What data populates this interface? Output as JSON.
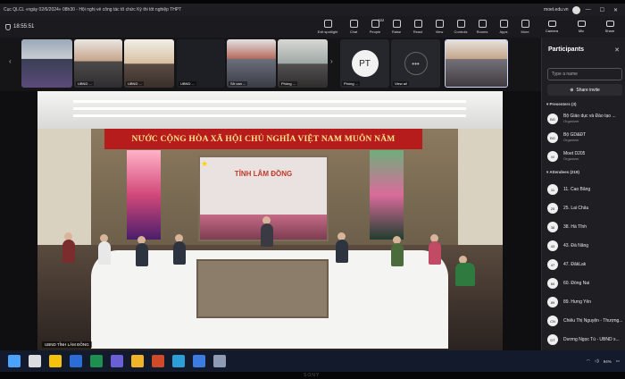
{
  "window": {
    "title": "Cục QLCL «ngày 02/6/2024» 08h30 - Hội nghị về công tác tổ chức Kỳ thi tốt nghiệp THPT",
    "account": "moet.edu.vn"
  },
  "meeting": {
    "elapsed": "18:55:51",
    "tools": [
      {
        "icon": "spotlight-icon",
        "label": "Exit spotlight"
      },
      {
        "icon": "chat-icon",
        "label": "Chat"
      },
      {
        "icon": "people-icon",
        "label": "People",
        "badge": "222"
      },
      {
        "icon": "raise-hand-icon",
        "label": "Raise"
      },
      {
        "icon": "react-icon",
        "label": "React"
      },
      {
        "icon": "view-icon",
        "label": "View"
      },
      {
        "icon": "controls-icon",
        "label": "Controls"
      },
      {
        "icon": "rooms-icon",
        "label": "Rooms"
      },
      {
        "icon": "apps-icon",
        "label": "Apps"
      },
      {
        "icon": "more-icon",
        "label": "More"
      }
    ],
    "camera_label": "Camera",
    "mic_label": "Mic",
    "share_label": "Share"
  },
  "strip": {
    "tiles": [
      {
        "label": ""
      },
      {
        "label": "UBND ..."
      },
      {
        "label": "UBND ..."
      },
      {
        "label": "UBND ..."
      },
      {
        "label": "Sở can ..."
      },
      {
        "label": "Phòng ..."
      },
      {
        "initials": "PT",
        "label": "Phòng ..."
      },
      {
        "more": "•••",
        "label": "View all"
      },
      {
        "label": ""
      }
    ]
  },
  "stage": {
    "banner": "NƯỚC CỘNG HÒA XÃ HỘI CHỦ NGHĨA VIỆT NAM MUÔN NĂM",
    "screen_text": "TỈNH LÂM ĐỒNG",
    "name_label": "UBND TỈNH LÂM ĐỒNG"
  },
  "participants": {
    "title": "Participants",
    "search_placeholder": "Type a name",
    "share_invite": "Share invite",
    "presenters_header": "Presenters (3)",
    "presenters": [
      {
        "initials": "BG",
        "name": "Bộ Giáo dục và Đào tạo ...",
        "role": "Organizer"
      },
      {
        "initials": "BG",
        "name": "Bộ GD&ĐT",
        "role": "Organizer"
      },
      {
        "initials": "M",
        "name": "Moet D205",
        "role": "Organizer"
      }
    ],
    "attendees_header": "Attendees (219)",
    "attendees": [
      {
        "initials": "11",
        "name": "11. Cao Bằng"
      },
      {
        "initials": "25",
        "name": "25. Lai Châu"
      },
      {
        "initials": "38",
        "name": "38. Hà Tĩnh"
      },
      {
        "initials": "43",
        "name": "43. Đà Nẵng"
      },
      {
        "initials": "47",
        "name": "47. ĐăkLak"
      },
      {
        "initials": "60",
        "name": "60. Đồng Nai"
      },
      {
        "initials": "89",
        "name": "89. Hưng Yên"
      },
      {
        "initials": "CN",
        "name": "Chiểu Thị Nguyện - Thượng..."
      },
      {
        "initials": "DT",
        "name": "Dương Ngọc Tú - UBND x..."
      }
    ]
  },
  "taskbar": {
    "icons": [
      "windows-start-icon",
      "search-icon",
      "chrome-icon",
      "word-icon",
      "excel-icon",
      "teams-icon",
      "file-explorer-icon",
      "powerpoint-icon",
      "edge-icon",
      "mail-icon",
      "app-icon"
    ],
    "battery": "94%",
    "brand": "SONY"
  }
}
